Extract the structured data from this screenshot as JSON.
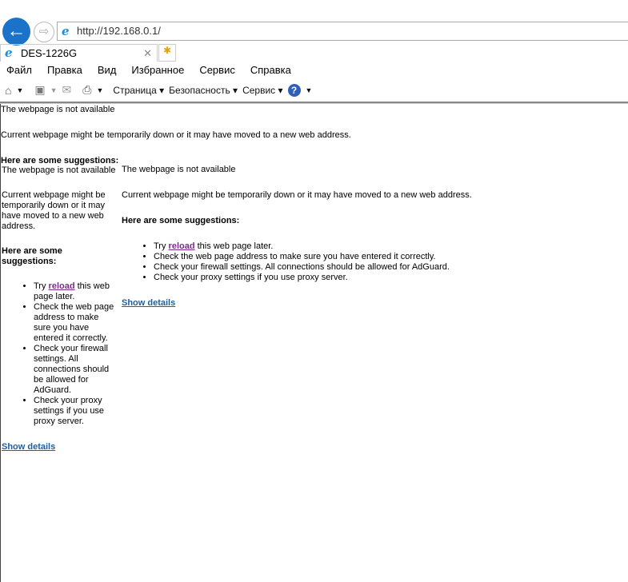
{
  "browser": {
    "url": "http://192.168.0.1/",
    "tab_title": "DES-1226G",
    "menu": [
      "Файл",
      "Правка",
      "Вид",
      "Избранное",
      "Сервис",
      "Справка"
    ],
    "toolbar": {
      "page": "Страница",
      "security": "Безопасность",
      "tools": "Сервис"
    }
  },
  "page": {
    "title": "The webpage is not available",
    "message": "Current webpage might be temporarily down or it may have moved to a new web address.",
    "suggestions_heading": "Here are some suggestions:",
    "try": "Try",
    "reload": "reload",
    "try_rest": "this web page later.",
    "s2": "Check the web page address to make sure you have entered it correctly.",
    "s3": "Check your firewall settings. All connections should be allowed for AdGuard.",
    "s4": "Check your proxy settings if you use proxy server.",
    "show_details": "Show details"
  }
}
